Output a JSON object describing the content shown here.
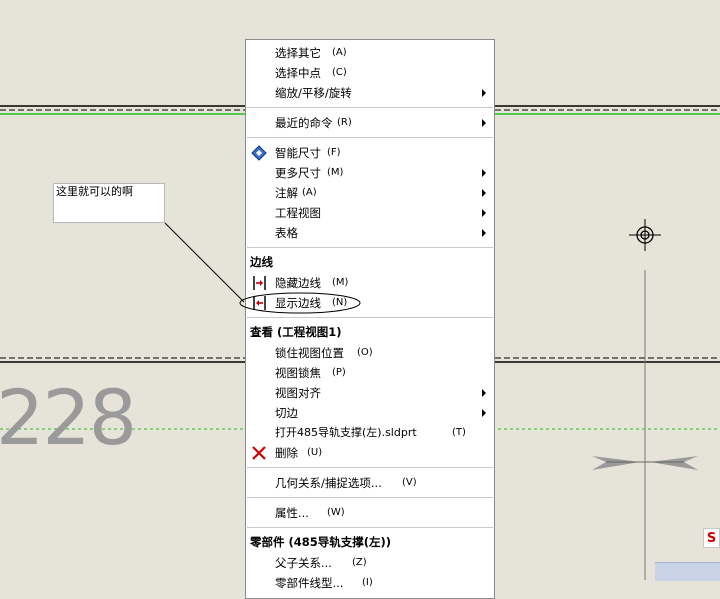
{
  "note_text": "这里就可以的啊",
  "dimension_text": "228",
  "corner_glyph": "S",
  "menu": {
    "group1": [
      {
        "label": "选择其它",
        "hotkey": "(A)",
        "submenu": false
      },
      {
        "label": "选择中点",
        "hotkey": "(C)",
        "submenu": false
      },
      {
        "label": "缩放/平移/旋转",
        "hotkey": "",
        "submenu": true
      }
    ],
    "group2": [
      {
        "label": "最近的命令",
        "hotkey": "(R)",
        "submenu": true
      }
    ],
    "group3": [
      {
        "label": "智能尺寸",
        "hotkey": "(F)",
        "submenu": false,
        "icon": "smart-dimension-icon"
      },
      {
        "label": "更多尺寸",
        "hotkey": "(M)",
        "submenu": true
      },
      {
        "label": "注解",
        "hotkey": "(A)",
        "submenu": true
      },
      {
        "label": "工程视图",
        "hotkey": "",
        "submenu": true
      },
      {
        "label": "表格",
        "hotkey": "",
        "submenu": true
      }
    ],
    "edges_header": "边线",
    "edges": [
      {
        "label": "隐藏边线",
        "hotkey": "(M)",
        "icon": "hide-edge-icon"
      },
      {
        "label": "显示边线",
        "hotkey": "(N)",
        "icon": "show-edge-icon"
      }
    ],
    "view_header": "查看 (工程视图1)",
    "view_items": [
      {
        "label": "锁住视图位置",
        "hotkey": "(O)",
        "submenu": false
      },
      {
        "label": "视图锁焦",
        "hotkey": "(P)",
        "submenu": false
      },
      {
        "label": "视图对齐",
        "hotkey": "",
        "submenu": true
      },
      {
        "label": "切边",
        "hotkey": "",
        "submenu": true
      },
      {
        "label": "打开485导轨支撑(左).sldprt",
        "hotkey": "(T)",
        "submenu": false
      },
      {
        "label": "删除",
        "hotkey": "(U)",
        "submenu": false,
        "icon": "delete-icon"
      }
    ],
    "group_relations": [
      {
        "label": "几何关系/捕捉选项...",
        "hotkey": "(V)"
      }
    ],
    "group_props": [
      {
        "label": "属性...",
        "hotkey": "(W)"
      }
    ],
    "part_header": "零部件 (485导轨支撑(左))",
    "part_items": [
      {
        "label": "父子关系...",
        "hotkey": "(Z)"
      },
      {
        "label": "零部件线型...",
        "hotkey": "(I)"
      }
    ]
  },
  "colors": {
    "canvas_bg": "#e6e3d8",
    "green_line": "#21c121",
    "delete_red": "#d00000"
  }
}
